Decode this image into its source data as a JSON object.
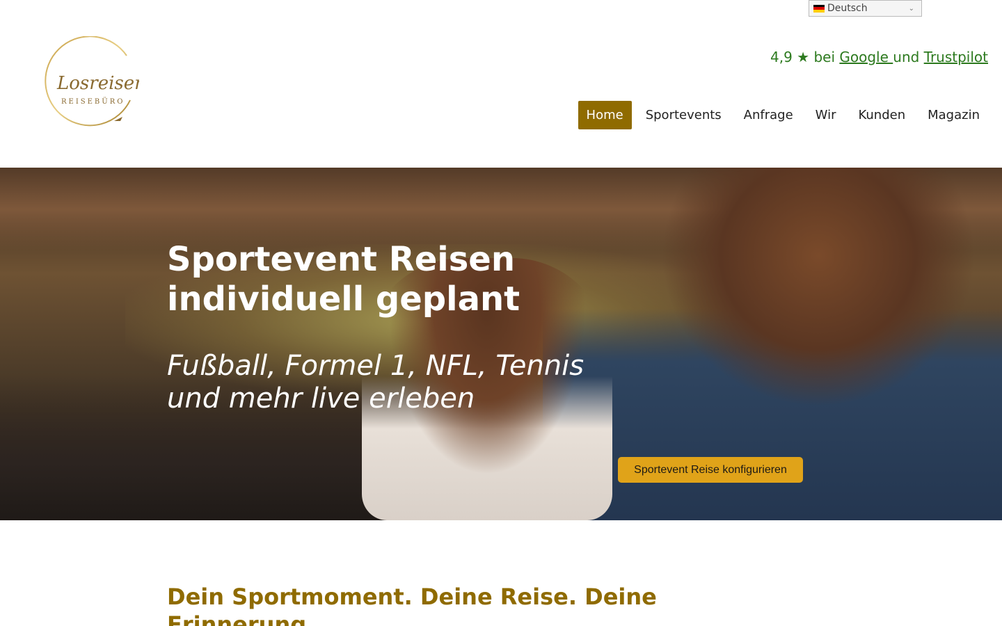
{
  "language": {
    "selected": "Deutsch"
  },
  "header": {
    "logo_text": "Losreisen",
    "logo_subtext": "REISEBÜRO",
    "rating": {
      "prefix": "4,9 ★ bei ",
      "google": "Google ",
      "middle": "und ",
      "trustpilot": "Trustpilot"
    }
  },
  "nav": {
    "items": [
      {
        "label": "Home"
      },
      {
        "label": "Sportevents"
      },
      {
        "label": "Anfrage"
      },
      {
        "label": "Wir"
      },
      {
        "label": "Kunden"
      },
      {
        "label": "Magazin"
      }
    ],
    "active": "Home"
  },
  "hero": {
    "title_line1": "Sportevent Reisen",
    "title_line2": "individuell geplant",
    "subtitle_line1": "Fußball, Formel 1, NFL, Tennis",
    "subtitle_line2": "und mehr live erleben",
    "cta_label": "Sportevent Reise konfigurieren"
  },
  "section": {
    "title": "Dein Sportmoment. Deine Reise. Deine Erinnerung."
  },
  "colors": {
    "accent": "#8f6b00",
    "cta": "#e0a319",
    "rating": "#2d7a1f"
  }
}
